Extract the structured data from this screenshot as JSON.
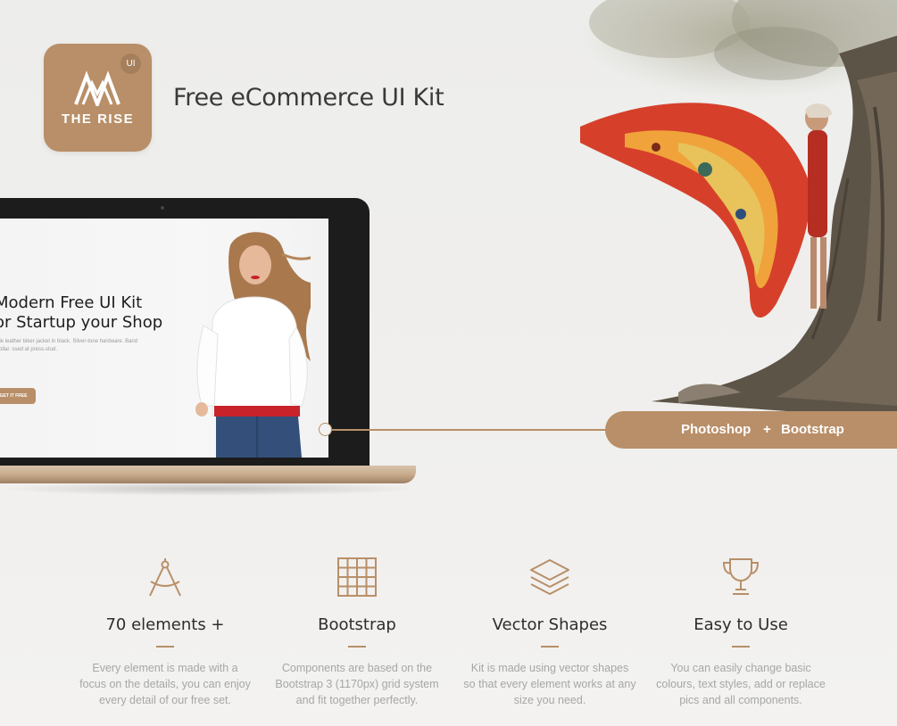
{
  "brand": {
    "badge": "UI",
    "name": "THE RISE"
  },
  "page_title": "Free eCommerce UI Kit",
  "mockup": {
    "headline_1": "Modern Free UI Kit",
    "headline_2": "or Startup your Shop",
    "description": "ple leather biker jacket in black. Silver-tone hardware. Band collar. ssed at press-stud.",
    "cta": "GET IT FREE"
  },
  "tech": {
    "left": "Photoshop",
    "plus": "+",
    "right": "Bootstrap"
  },
  "features": [
    {
      "icon": "compass-icon",
      "title": "70 elements +",
      "text": [
        "Every element is made with a",
        "focus on the details, you can enjoy",
        "every detail of our free set."
      ]
    },
    {
      "icon": "grid-icon",
      "title": "Bootstrap",
      "text": [
        "Components are based on the",
        "Bootstrap 3 (1170px) grid system",
        "and fit together perfectly."
      ]
    },
    {
      "icon": "layers-icon",
      "title": "Vector Shapes",
      "text": [
        "Kit is made using vector shapes",
        "so that every element works at any",
        "size you need."
      ]
    },
    {
      "icon": "trophy-icon",
      "title": "Easy to Use",
      "text": [
        "You can easily change basic",
        "colours, text styles, add or replace",
        "pics and all components."
      ]
    }
  ],
  "colors": {
    "accent": "#b88f68",
    "background": "#efeeec",
    "text": "#333333",
    "muted": "#a7a7a7"
  }
}
